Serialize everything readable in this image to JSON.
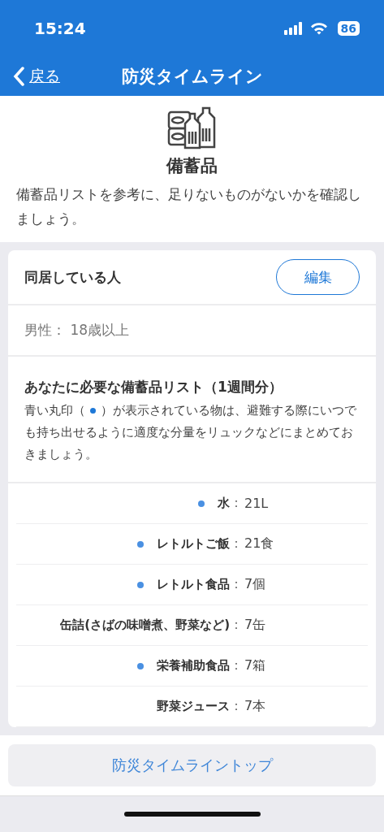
{
  "status_bar": {
    "time": "15:24",
    "battery": "86"
  },
  "nav": {
    "back": "戻る",
    "title": "防災タイムライン"
  },
  "header": {
    "title": "備蓄品",
    "description": "備蓄品リストを参考に、足りないものがないかを確認しましょう。"
  },
  "household": {
    "title": "同居している人",
    "edit_button": "編集",
    "members": [
      "男性： 18歳以上"
    ]
  },
  "list": {
    "title": "あなたに必要な備蓄品リスト（1週間分）",
    "note_before": "青い丸印（",
    "note_after": "）が表示されている物は、避難する際にいつでも持ち出せるように適度な分量をリュックなどにまとめておきましょう。",
    "separator": "：",
    "items": [
      {
        "name": "水",
        "amount": "21L",
        "marked": true
      },
      {
        "name": "レトルトご飯",
        "amount": "21食",
        "marked": true
      },
      {
        "name": "レトルト食品",
        "amount": "7個",
        "marked": true
      },
      {
        "name": "缶詰(さばの味噌煮、野菜など)",
        "amount": "7缶",
        "marked": false
      },
      {
        "name": "栄養補助食品",
        "amount": "7箱",
        "marked": true
      },
      {
        "name": "野菜ジュース",
        "amount": "7本",
        "marked": false
      }
    ]
  },
  "footer": {
    "button": "防災タイムライントップ"
  }
}
